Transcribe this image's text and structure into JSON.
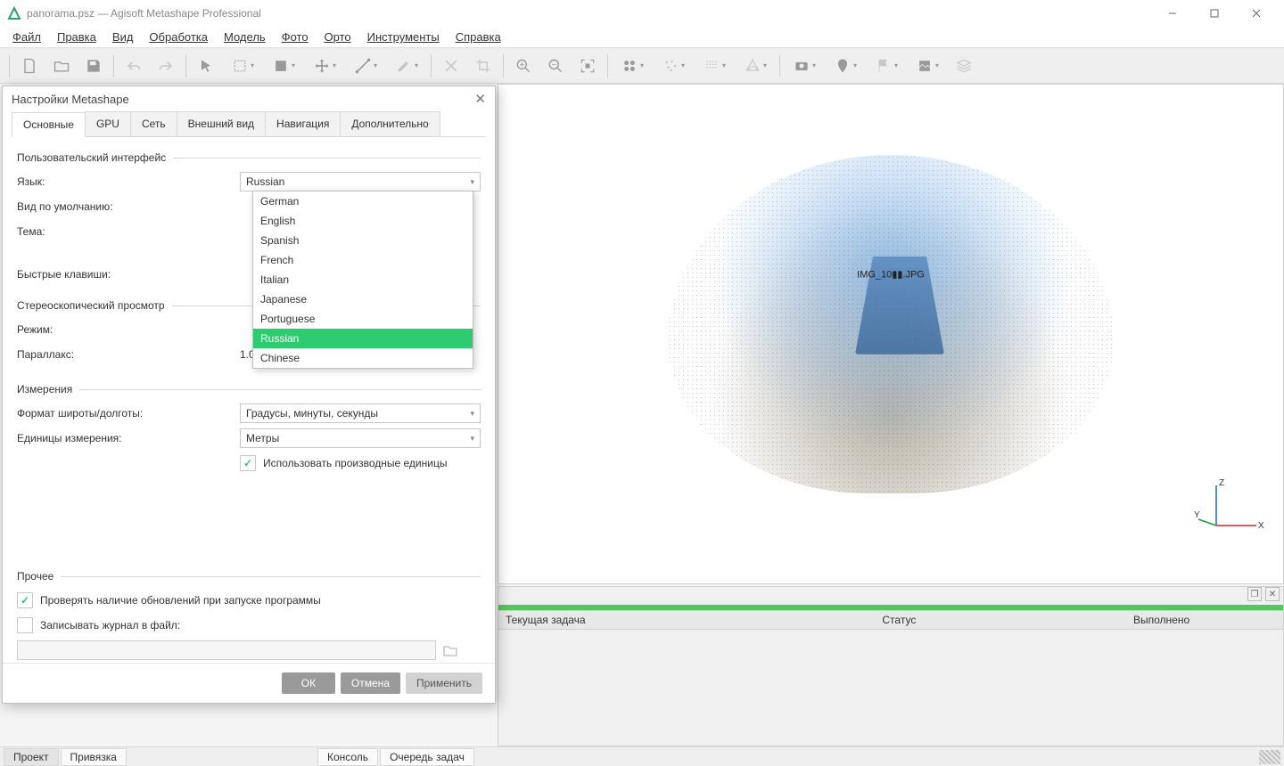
{
  "titlebar": {
    "title": "panorama.psz — Agisoft Metashape Professional"
  },
  "menu": [
    "Файл",
    "Правка",
    "Вид",
    "Обработка",
    "Модель",
    "Фото",
    "Орто",
    "Инструменты",
    "Справка"
  ],
  "dialog": {
    "title": "Настройки Metashape",
    "tabs": [
      "Основные",
      "GPU",
      "Сеть",
      "Внешний вид",
      "Навигация",
      "Дополнительно"
    ],
    "group_ui": "Пользовательский интерфейс",
    "language_label": "Язык:",
    "language_value": "Russian",
    "language_options": [
      "German",
      "English",
      "Spanish",
      "French",
      "Italian",
      "Japanese",
      "Portuguese",
      "Russian",
      "Chinese"
    ],
    "default_view_label": "Вид по умолчанию:",
    "theme_label": "Тема:",
    "shortcuts_label": "Быстрые клавиши:",
    "group_stereo": "Стереоскопический просмотр",
    "mode_label": "Режим:",
    "parallax_label": "Параллакс:",
    "parallax_value": "1.0",
    "group_measure": "Измерения",
    "latlon_label": "Формат широты/долготы:",
    "latlon_value": "Градусы, минуты, секунды",
    "units_label": "Единицы измерения:",
    "units_value": "Метры",
    "derived_checkbox": "Использовать производные единицы",
    "group_other": "Прочее",
    "check_updates": "Проверять наличие обновлений при запуске программы",
    "write_log": "Записывать журнал в файл:",
    "ok": "ОК",
    "cancel": "Отмена",
    "apply": "Применить"
  },
  "viewport": {
    "image_label": "IMG_10▮▮.JPG",
    "axes": {
      "x": "X",
      "y": "Y",
      "z": "Z"
    }
  },
  "tasks": {
    "cols": [
      "Текущая задача",
      "Статус",
      "Выполнено"
    ]
  },
  "statusbar": {
    "tabs_left": [
      "Проект",
      "Привязка"
    ],
    "tabs_right": [
      "Консоль",
      "Очередь задач"
    ]
  }
}
